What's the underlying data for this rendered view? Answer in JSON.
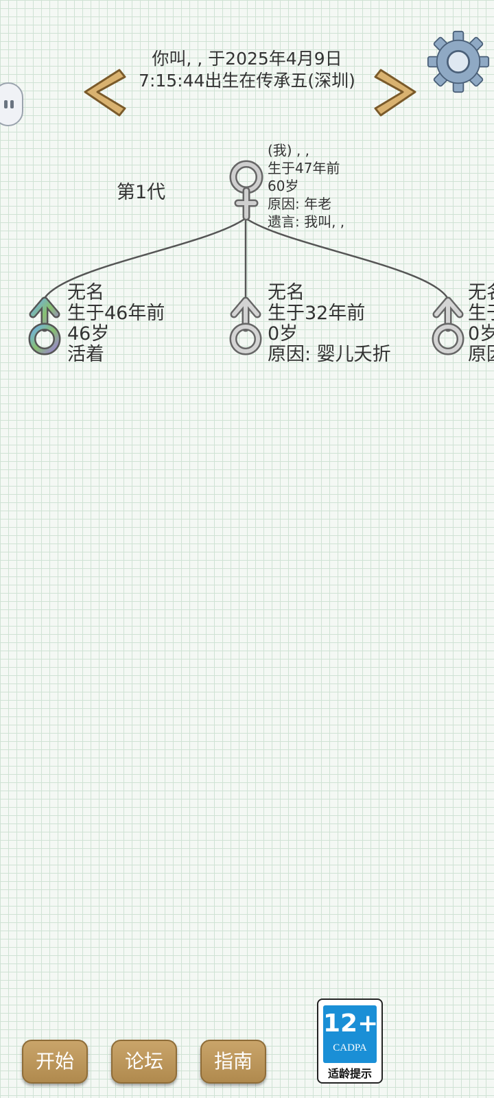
{
  "header": {
    "line1": "你叫, , 于2025年4月9日",
    "line2": "7:15:44出生在传承五(深圳)"
  },
  "icons": {
    "prev": "chevron-left-icon",
    "next": "chevron-right-icon",
    "settings": "gear-icon",
    "side": "pause-icon",
    "female": "female-symbol-icon",
    "male": "male-symbol-icon"
  },
  "generation": {
    "label": "第1代"
  },
  "root": {
    "line1": "(我) , ,",
    "line2": "生于47年前",
    "line3": "60岁",
    "line4": "原因:  年老",
    "line5": "遗言:  我叫, ,"
  },
  "children": [
    {
      "name": "无名",
      "born": "生于46年前",
      "age": "46岁",
      "status": "活着"
    },
    {
      "name": "无名",
      "born": "生于32年前",
      "age": "0岁",
      "status": "原因:  婴儿夭折"
    },
    {
      "name": "无名",
      "born": "生于",
      "age": "0岁",
      "status": "原因:"
    }
  ],
  "buttons": {
    "start": "开始",
    "forum": "论坛",
    "guide": "指南"
  },
  "age_rating": {
    "number": "12+",
    "org": "CADPA",
    "tip": "适龄提示"
  },
  "colors": {
    "button": "#b99458",
    "grid": "#cfe2d4",
    "arrow": "#d9b270",
    "rating_blue": "#1a8fd6"
  }
}
